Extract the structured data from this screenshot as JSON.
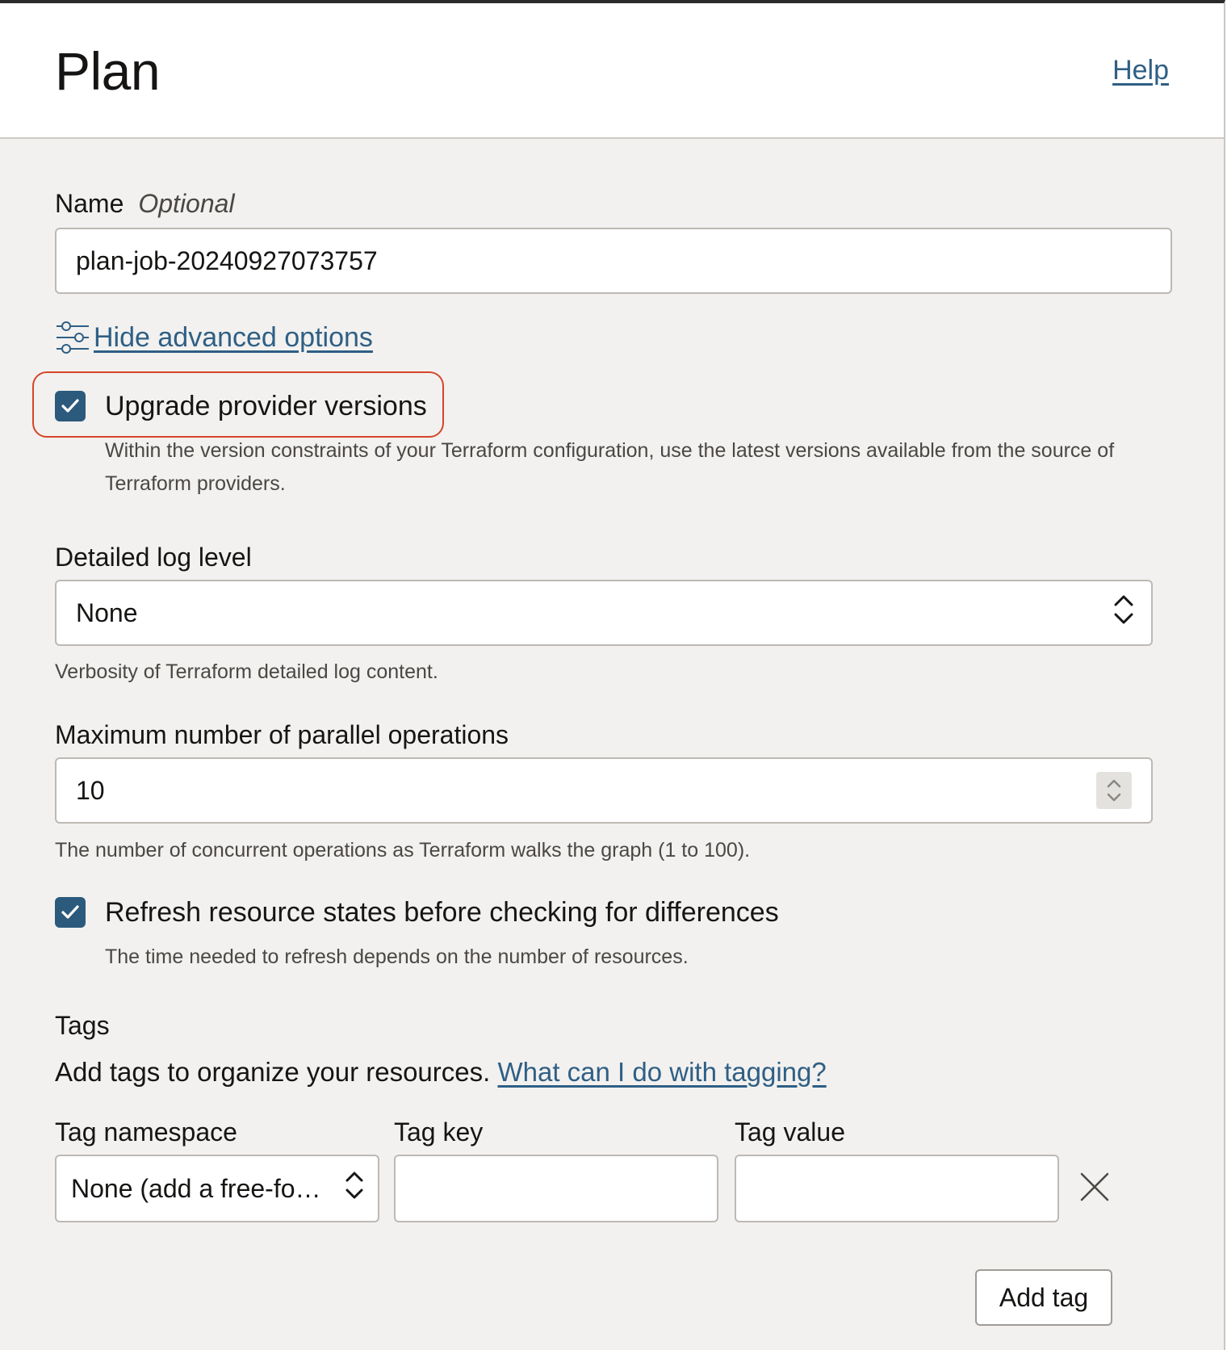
{
  "header": {
    "title": "Plan",
    "help_label": "Help"
  },
  "name_field": {
    "label": "Name",
    "optional_label": "Optional",
    "value": "plan-job-20240927073757"
  },
  "advanced": {
    "toggle_label": "Hide advanced options",
    "icon": "sliders-icon"
  },
  "upgrade_providers": {
    "checked": true,
    "label": "Upgrade provider versions",
    "help": "Within the version constraints of your Terraform configuration, use the latest versions available from the source of Terraform providers."
  },
  "log_level": {
    "label": "Detailed log level",
    "selected": "None",
    "help": "Verbosity of Terraform detailed log content."
  },
  "parallelism": {
    "label": "Maximum number of parallel operations",
    "value": "10",
    "help": "The number of concurrent operations as Terraform walks the graph (1 to 100)."
  },
  "refresh": {
    "checked": true,
    "label": "Refresh resource states before checking for differences",
    "help": "The time needed to refresh depends on the number of resources."
  },
  "tags": {
    "heading": "Tags",
    "description": "Add tags to organize your resources.",
    "learn_link": "What can I do with tagging?",
    "namespace_label": "Tag namespace",
    "namespace_selected": "None (add a free-fo…",
    "key_label": "Tag key",
    "key_value": "",
    "value_label": "Tag value",
    "value_value": "",
    "add_button": "Add tag"
  },
  "colors": {
    "accent": "#2c5a7c",
    "link": "#2f5f85",
    "highlight": "#d6452a",
    "background": "#f2f1ef"
  }
}
